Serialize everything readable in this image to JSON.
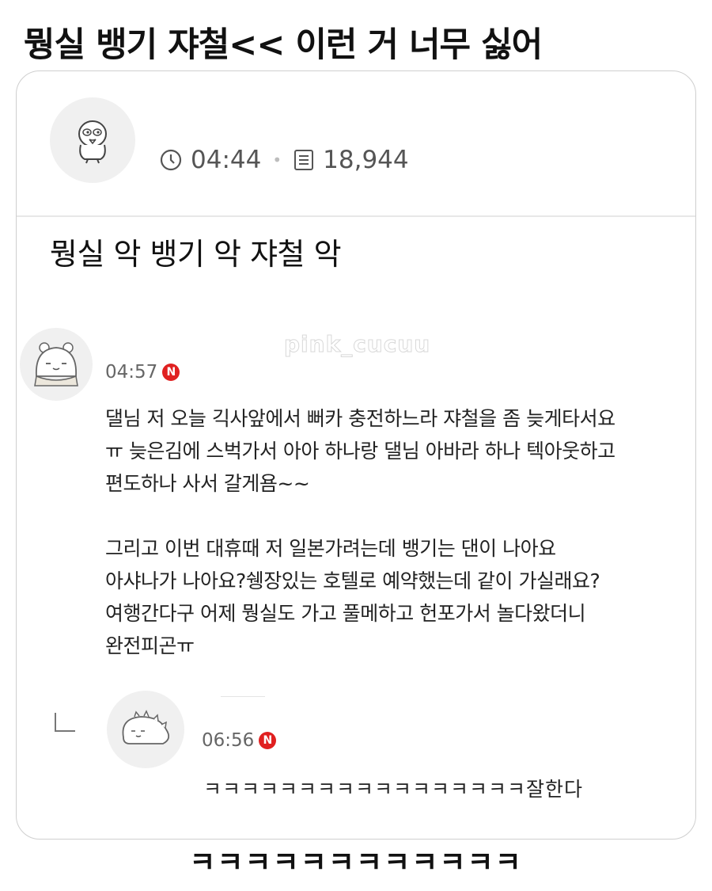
{
  "title": "뭥실 뱅기 쟈철<< 이런 거 너무 싫어",
  "post": {
    "time": "04:44",
    "views": "18,944",
    "title": "뭥실 악 뱅기 악 쟈철 악",
    "watermark": "pink_cucuu"
  },
  "comments": [
    {
      "time": "04:57",
      "badge": "N",
      "lines": [
        "댈님 저 오늘 긱사앞에서 뻐카 충전하느라 쟈철을 좀 늦게타서요",
        "ㅠ 늦은김에 스벅가서 아아 하나랑 댈님 아바라 하나 텍아웃하고",
        "편도하나 사서 갈게욤~~",
        "그리고 이번 대휴때 저 일본가려는데 뱅기는 댄이 나아요",
        "아샤나가 나아요?쉥장있는 호텔로 예약했는데 같이 가실래요?",
        "여행간다구 어제 뭥실도 가고 풀메하고 헌포가서 놀다왔더니",
        "완전피곤ㅠ"
      ]
    },
    {
      "time": "06:56",
      "badge": "N",
      "text": "ㅋㅋㅋㅋㅋㅋㅋㅋㅋㅋㅋㅋㅋㅋㅋㅋㅋ잘한다"
    }
  ],
  "caption": "ㅋㅋㅋㅋㅋㅋㅋㅋㅋㅋㅋㅋ",
  "icons": {
    "clock": "clock-icon",
    "views": "document-icon",
    "reply": "reply-arrow-icon"
  },
  "colors": {
    "badge": "#e02020",
    "meta_text": "#555555",
    "card_border": "#cfcfcf"
  }
}
